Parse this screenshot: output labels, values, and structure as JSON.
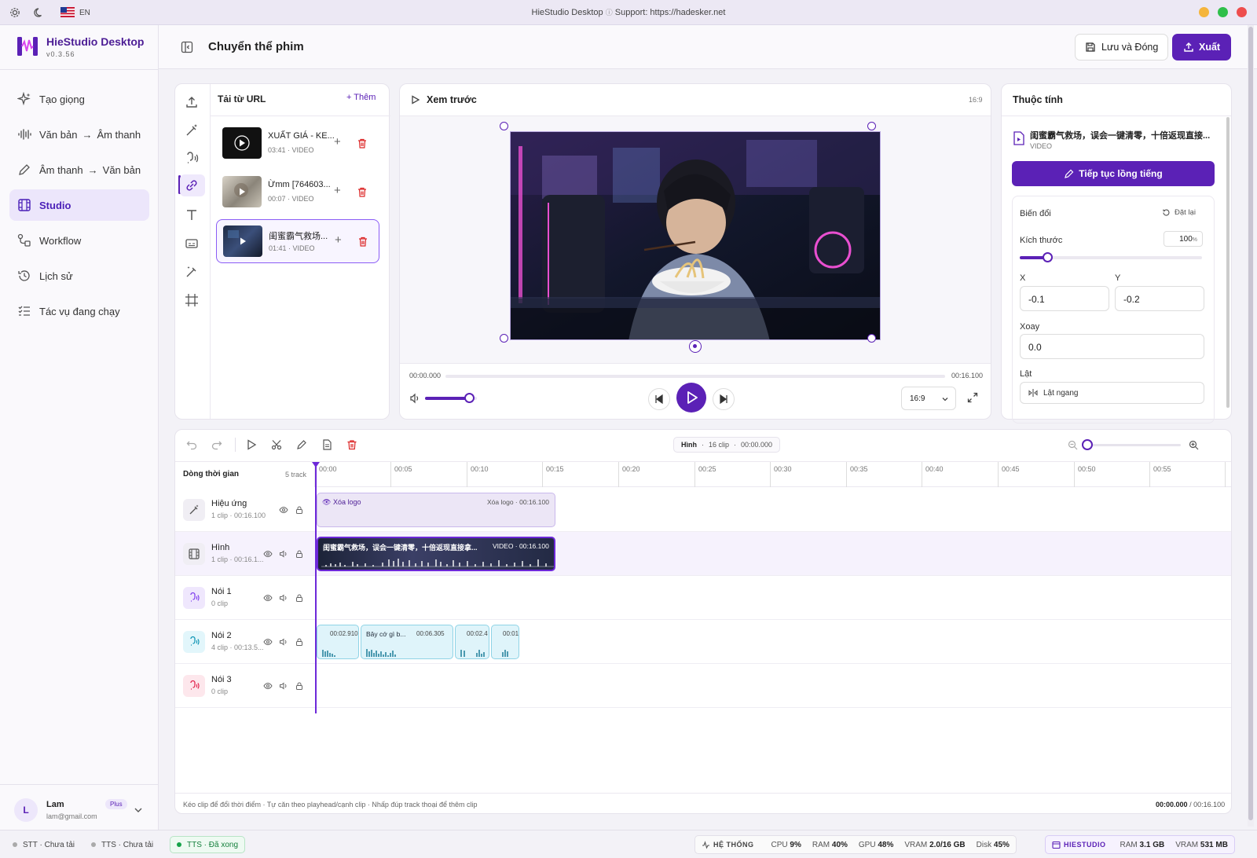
{
  "titlebar": {
    "title": "HieStudio Desktop",
    "support": "Support: https://hadesker.net",
    "lang": "EN"
  },
  "brand": {
    "name": "HieStudio Desktop",
    "version": "v0.3.56"
  },
  "nav": [
    {
      "label": "Tạo giọng",
      "icon": "sparkle-icon"
    },
    {
      "label_a": "Văn bản",
      "label_b": "Âm thanh",
      "icon": "waveform-icon"
    },
    {
      "label_a": "Âm thanh",
      "label_b": "Văn bản",
      "icon": "pen-icon"
    },
    {
      "label": "Studio",
      "icon": "film-icon",
      "active": true
    },
    {
      "label": "Workflow",
      "icon": "workflow-icon"
    },
    {
      "label": "Lịch sử",
      "icon": "history-icon"
    },
    {
      "label": "Tác vụ đang chạy",
      "icon": "tasks-icon"
    }
  ],
  "user": {
    "initial": "L",
    "name": "Lam",
    "email": "lam@gmail.com",
    "plan": "Plus"
  },
  "header": {
    "title": "Chuyển thể phim",
    "save_label": "Lưu và Đóng",
    "export_label": "Xuất"
  },
  "media": {
    "title": "Tải từ URL",
    "add_label": "Thêm",
    "items": [
      {
        "title": "XUẤT GIÁ - KE...",
        "meta": "03:41 · VIDEO"
      },
      {
        "title": "Ừmm [764603...",
        "meta": "00:07 · VIDEO"
      },
      {
        "title": "闺蜜霸气救场...",
        "meta": "01:41 · VIDEO"
      }
    ]
  },
  "preview": {
    "title": "Xem trước",
    "ratio": "16:9",
    "time_start": "00:00.000",
    "time_end": "00:16.100",
    "ratio_select": "16:9",
    "volume": 0.85
  },
  "props": {
    "title": "Thuộc tính",
    "file_name": "闺蜜霸气救场，误会一键清零，十倍返现直接...",
    "file_type": "VIDEO",
    "dub_button": "Tiếp tục lồng tiếng",
    "transform_label": "Biến đổi",
    "reset_label": "Đặt lại",
    "size_label": "Kích thước",
    "size_value": "100",
    "size_unit": "%",
    "size_level": 0.15,
    "x_label": "X",
    "y_label": "Y",
    "x_value": "-0.1",
    "y_value": "-0.2",
    "rotate_label": "Xoay",
    "rotate_value": "0.0",
    "flip_label": "Lật",
    "flip_h": "Lật ngang"
  },
  "timeline": {
    "info_track": "Hình",
    "info_clips": "16 clip",
    "info_time": "00:00.000",
    "header_label": "Dòng thời gian",
    "track_count": "5 track",
    "ticks": [
      "00:00",
      "00:05",
      "00:10",
      "00:15",
      "00:20",
      "00:25",
      "00:30",
      "00:35",
      "00:40",
      "00:45",
      "00:50",
      "00:55"
    ],
    "tracks": [
      {
        "name": "Hiệu ứng",
        "sub": "1 clip · 00:16.100"
      },
      {
        "name": "Hình",
        "sub": "1 clip · 00:16.1..."
      },
      {
        "name": "Nói 1",
        "sub": "0 clip"
      },
      {
        "name": "Nói 2",
        "sub": "4 clip · 00:13.5..."
      },
      {
        "name": "Nói 3",
        "sub": "0 clip"
      }
    ],
    "fx_clip": {
      "left": "Xóa logo",
      "right": "Xóa logo · 00:16.100"
    },
    "video_clip": {
      "title": "闺蜜霸气救场，误会一键清零，十倍返现直接拿...",
      "tag": "VIDEO · 00:16.100"
    },
    "voice_clips": [
      {
        "label": "",
        "time": "00:02.910"
      },
      {
        "label": "Bây cớ gì b...",
        "time": "00:06.305"
      },
      {
        "label": "",
        "time": "00:02.4"
      },
      {
        "label": "",
        "time": "00:01"
      }
    ],
    "hint": "Kéo clip để đổi thời điểm · Tự căn theo playhead/cạnh clip · Nhấp đúp track thoại để thêm clip",
    "time_cur": "00:00.000",
    "time_total": "/ 00:16.100"
  },
  "status": {
    "stt": "STT · Chưa tải",
    "tts_off": "TTS · Chưa tải",
    "tts_done": "TTS · Đã xong",
    "system_label": "HỆ THỐNG",
    "cpu_label": "CPU",
    "cpu": "9%",
    "ram_label": "RAM",
    "ram": "40%",
    "gpu_label": "GPU",
    "gpu": "48%",
    "vram_label": "VRAM",
    "vram": "2.0/16 GB",
    "disk_label": "Disk",
    "disk": "45%",
    "app_label": "HIESTUDIO",
    "app_ram_label": "RAM",
    "app_ram": "3.1 GB",
    "app_vram_label": "VRAM",
    "app_vram": "531 MB"
  },
  "colors": {
    "accent": "#5b21b6",
    "danger": "#dc2626",
    "success": "#16a34a"
  }
}
